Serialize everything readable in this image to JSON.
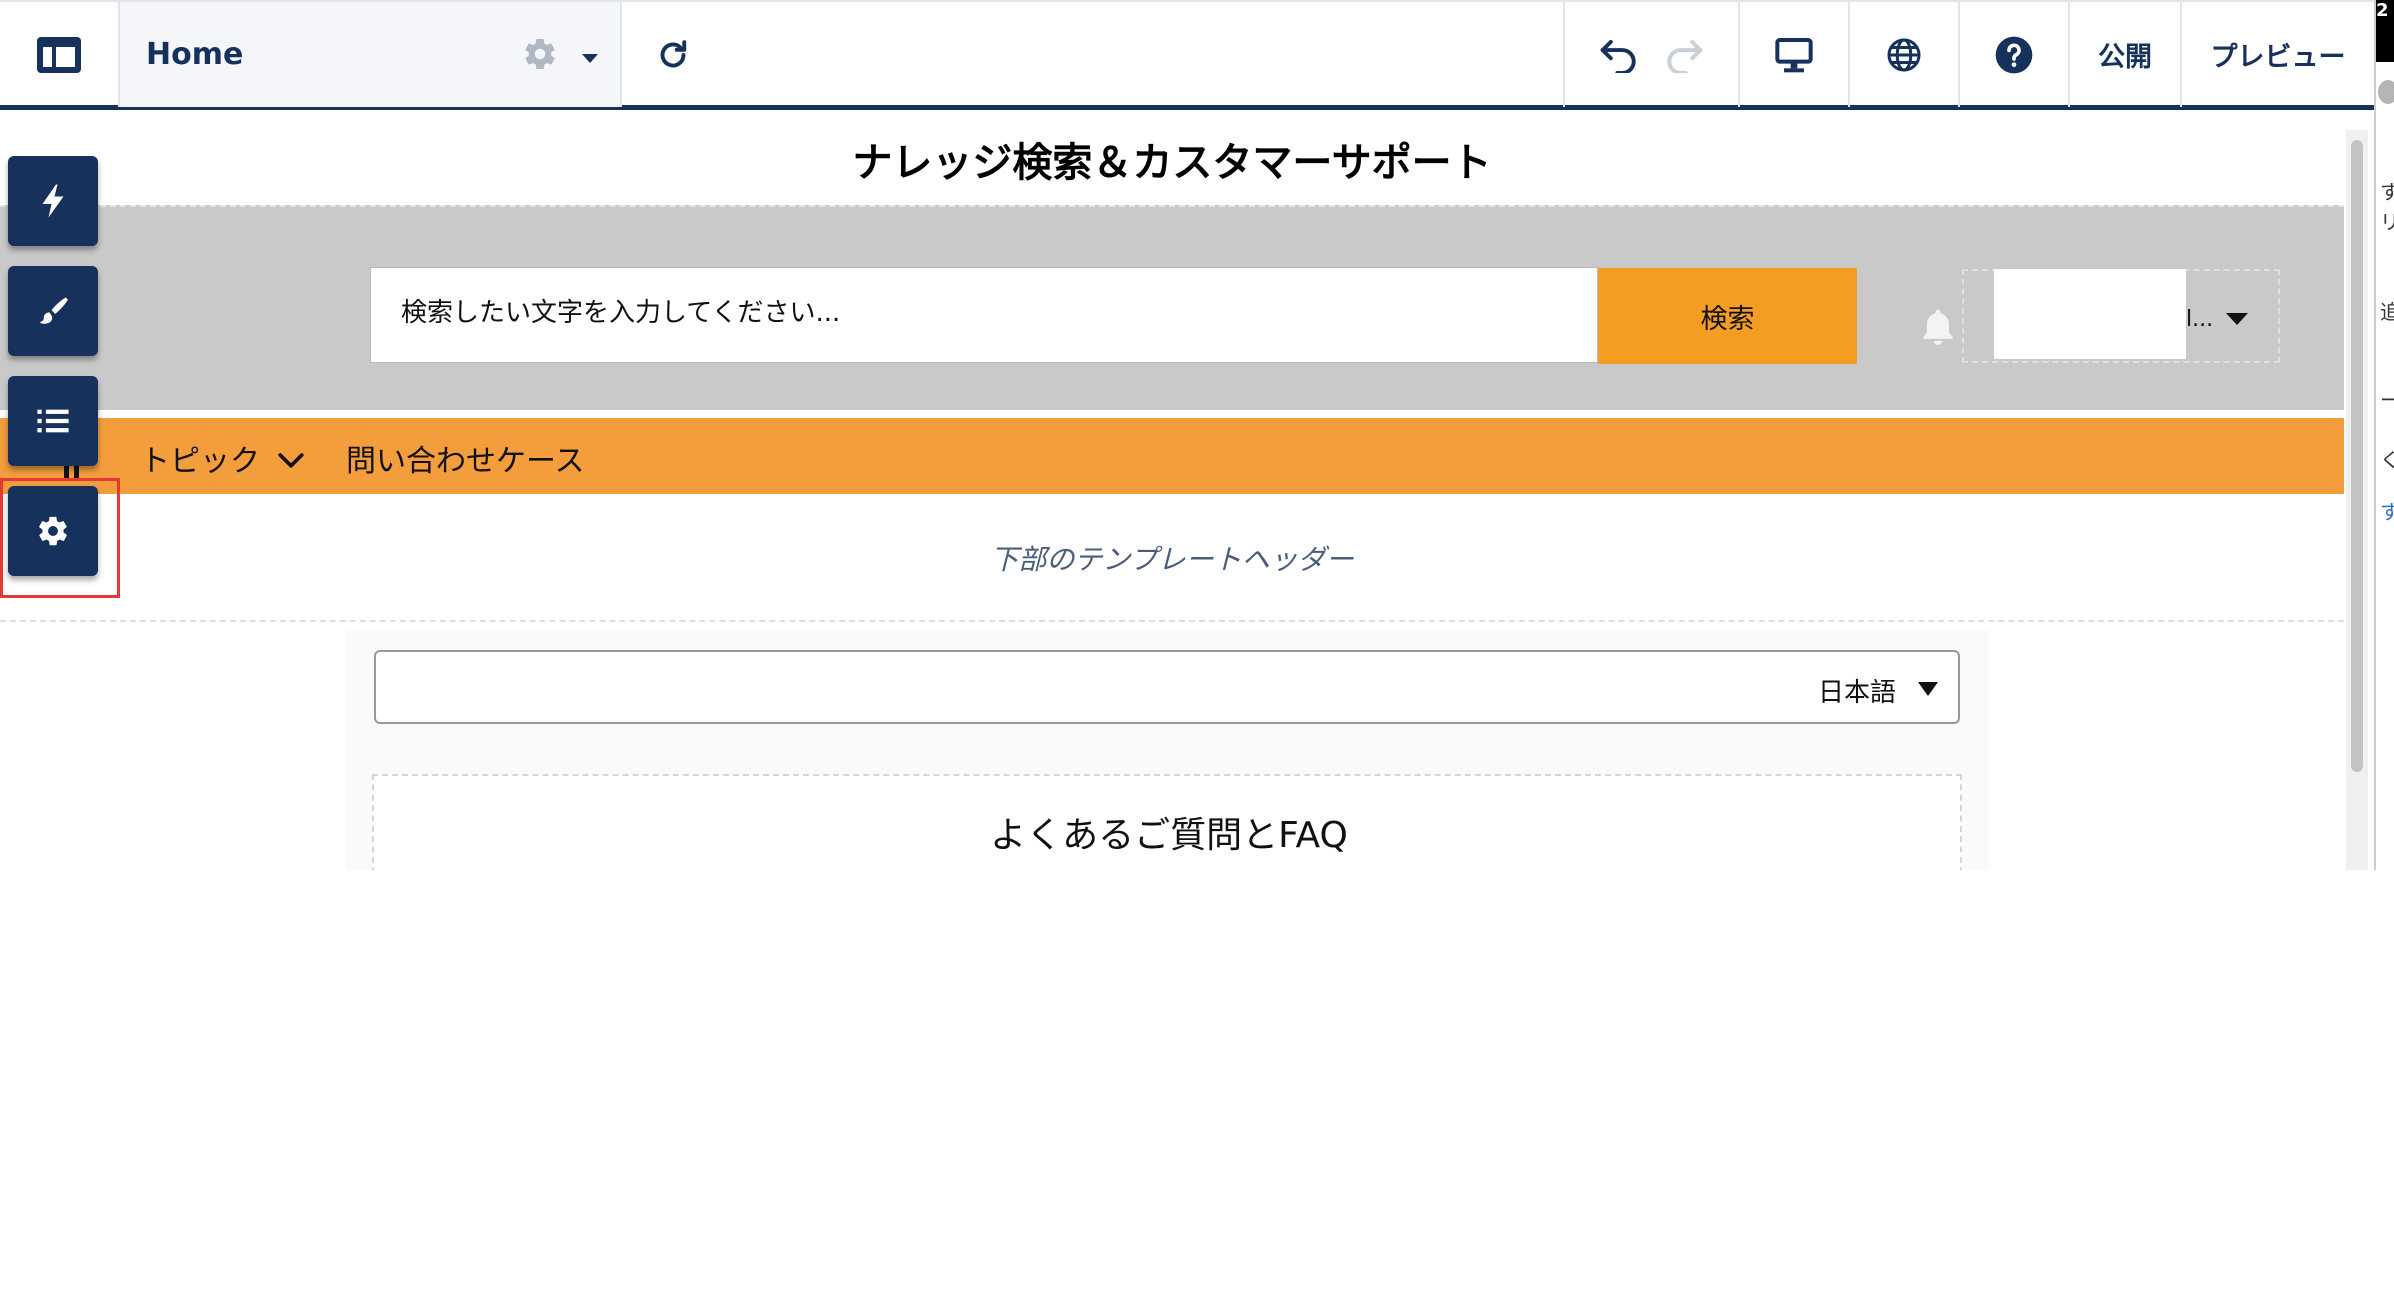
{
  "toolbar": {
    "page_name": "Home",
    "publish_label": "公開",
    "preview_label": "プレビュー"
  },
  "right_strip": {
    "badge": "2",
    "fragments": [
      "す",
      "リ",
      "追",
      "ー",
      "く",
      "す"
    ]
  },
  "site": {
    "title": "ナレッジ検索＆カスタマーサポート",
    "search": {
      "placeholder": "検索したい文字を入力してください...",
      "button_label": "検索"
    },
    "user_name_fragment": "l..."
  },
  "nav": {
    "items": [
      {
        "label": "トピック"
      },
      {
        "label": "問い合わせケース"
      }
    ]
  },
  "template_header_label": "下部のテンプレートヘッダー",
  "language_selector": {
    "selected": "日本語"
  },
  "faq": {
    "title": "よくあるご質問とFAQ"
  },
  "side_panel": {
    "buttons": [
      "lightning-icon",
      "paintbrush-icon",
      "list-icon",
      "gear-icon"
    ],
    "selected": "gear-icon"
  },
  "colors": {
    "navy": "#16325c",
    "orange_button": "#f49d23",
    "orange_nav": "#f49d3d",
    "hero_gray": "#c9c9c9",
    "highlight": "#e53935"
  }
}
